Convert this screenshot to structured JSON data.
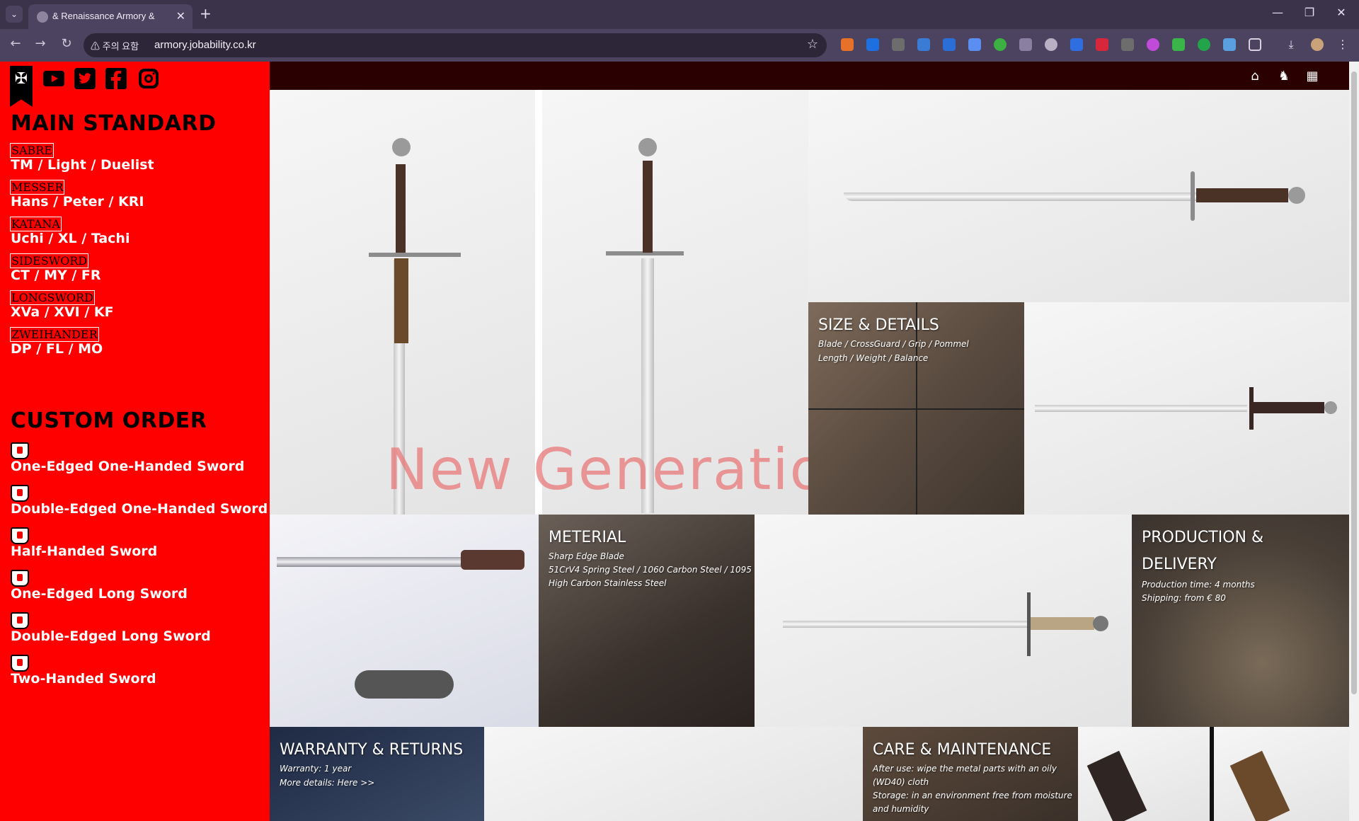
{
  "browser": {
    "tab_title": "& Renaissance Armory &",
    "security_label": "주의 요함",
    "url": "armory.jobability.co.kr"
  },
  "sidebar": {
    "main_title": "MAIN STANDARD",
    "categories": [
      {
        "label": "SABRE",
        "links": "TM / Light / Duelist"
      },
      {
        "label": "MESSER",
        "links": "Hans / Peter / KRI"
      },
      {
        "label": "KATANA",
        "links": "Uchi / XL / Tachi"
      },
      {
        "label": "SIDESWORD",
        "links": "CT / MY / FR"
      },
      {
        "label": "LONGSWORD",
        "links": "XVa / XVI / KF"
      },
      {
        "label": "ZWEIHANDER",
        "links": "DP / FL / MO"
      }
    ],
    "custom_title": "CUSTOM ORDER",
    "custom_items": [
      "One-Edged One-Handed Sword",
      "Double-Edged One-Handed Sword",
      "Half-Handed Sword",
      "One-Edged Long Sword",
      "Double-Edged Long Sword",
      "Two-Handed Sword"
    ]
  },
  "tiles": {
    "watermark": "New Generation",
    "size": {
      "title": "SIZE & DETAILS",
      "line1": "Blade / CrossGuard / Grip / Pommel",
      "line2": "Length / Weight / Balance"
    },
    "material": {
      "title": "METERIAL",
      "line1": "Sharp Edge Blade",
      "line2": "51CrV4 Spring Steel / 1060 Carbon Steel / 1095",
      "line3": "High Carbon Stainless Steel"
    },
    "production": {
      "title_line1": "PRODUCTION &",
      "title_line2": "DELIVERY",
      "line1": "Production time: 4 months",
      "line2": "Shipping: from € 80"
    },
    "warranty": {
      "title": "WARRANTY & RETURNS",
      "line1": "Warranty: 1 year",
      "line2": "More details: Here >>"
    },
    "care": {
      "title": "CARE & MAINTENANCE",
      "line1": "After use: wipe the metal parts with an oily",
      "line2": "(WD40) cloth",
      "line3": "Storage: in an environment free from moisture",
      "line4": "and humidity"
    }
  },
  "colors": {
    "sidebar": "#ff0000",
    "topbar": "#2b0000",
    "chrome": "#3b334a"
  }
}
